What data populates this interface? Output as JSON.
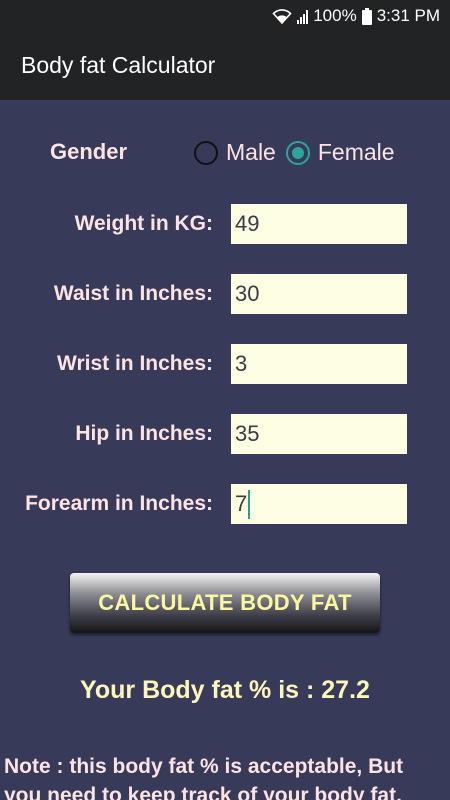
{
  "status_bar": {
    "battery_percent": "100%",
    "time": "3:31 PM"
  },
  "app_bar": {
    "title": "Body fat Calculator"
  },
  "gender": {
    "label": "Gender",
    "options": [
      "Male",
      "Female"
    ],
    "selected": "Female"
  },
  "fields": [
    {
      "label": "Weight in KG:",
      "value": "49"
    },
    {
      "label": "Waist in Inches:",
      "value": "30"
    },
    {
      "label": "Wrist in Inches:",
      "value": "3"
    },
    {
      "label": "Hip in Inches:",
      "value": "35"
    },
    {
      "label": "Forearm in Inches:",
      "value": "7"
    }
  ],
  "calculate_button": {
    "label": "CALCULATE  BODY FAT"
  },
  "result": {
    "text": "Your Body fat % is : 27.2"
  },
  "note": {
    "line1": "Note : this body fat % is acceptable, But",
    "line2": "you need to keep track of your body fat."
  },
  "colors": {
    "background": "#383a59",
    "app_bar": "#222325",
    "label_text": "#fde4e3",
    "input_background": "#fefee2",
    "accent_radio": "#2aa79a",
    "button_text": "#fdf6a0",
    "result_text": "#fdf6ba"
  }
}
